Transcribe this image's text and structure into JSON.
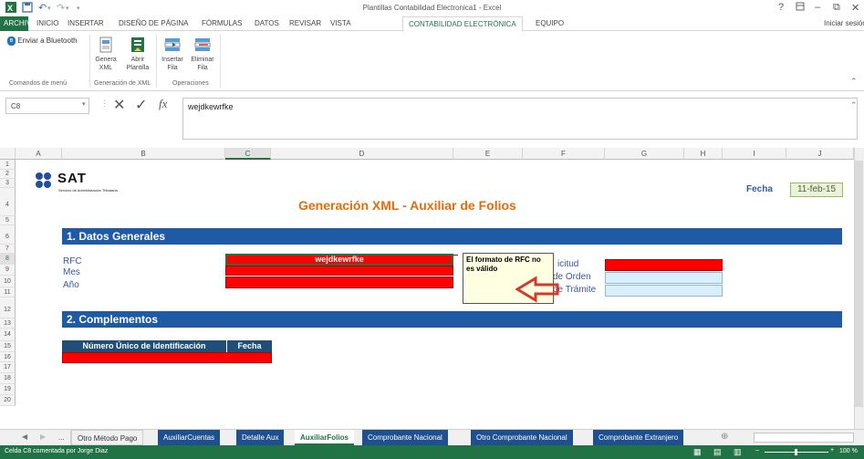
{
  "title_bar": {
    "title": "Plantillas Contabilidad Electronica1 - Excel",
    "help": "?",
    "minimize": "–",
    "restore": "⧉",
    "close": "✕"
  },
  "menu": {
    "file": "ARCHIVO",
    "tabs": [
      "INICIO",
      "INSERTAR",
      "DISEÑO DE PÁGINA",
      "FÓRMULAS",
      "DATOS",
      "REVISAR",
      "VISTA",
      "CONTABILIDAD ELECTRÓNICA",
      "EQUIPO"
    ],
    "signin": "Iniciar sesión"
  },
  "ribbon": {
    "bluetooth": "Enviar a Bluetooth",
    "genera": [
      "Genera",
      "XML"
    ],
    "abrir": [
      "Abrir",
      "Plantilla"
    ],
    "insertar": [
      "Insertar",
      "Fila"
    ],
    "eliminar": [
      "Eliminar",
      "Fila"
    ],
    "groups": [
      "Comandos de menú",
      "Generación de XML",
      "Operaciones"
    ]
  },
  "formula_bar": {
    "namebox": "C8",
    "fx": "fx",
    "value": "wejdkewrfke"
  },
  "columns": [
    "A",
    "B",
    "C",
    "D",
    "E",
    "F",
    "G",
    "H",
    "I",
    "J"
  ],
  "rows": [
    "1",
    "2",
    "3",
    "4",
    "5",
    "6",
    "7",
    "8",
    "9",
    "10",
    "11",
    "12",
    "13",
    "14",
    "15",
    "16",
    "17",
    "18",
    "19",
    "20"
  ],
  "sheet": {
    "logo_text": "SAT",
    "logo_sub": "Servicio de Administración Tributaria",
    "main_title": "Generación XML - Auxiliar de Folios",
    "fecha_label": "Fecha",
    "fecha_value": "11-feb-15",
    "section1": "1. Datos Generales",
    "rfc": "RFC",
    "mes": "Mes",
    "anio": "Año",
    "rfc_value": "wejdkewrfke",
    "comment": "El formato de RFC no es válido",
    "right_labels": [
      "icitud",
      "de Orden",
      "de Trámite"
    ],
    "section2": "2. Complementos",
    "table_headers": [
      "Número Único de Identificación",
      "Fecha"
    ]
  },
  "sheet_tabs": [
    "...",
    "Otro Método Pago",
    "AuxiliarCuentas",
    "Detalle Aux",
    "AuxiliarFolios",
    "Comprobante Nacional",
    "Otro Comprobante Nacional",
    "Comprobante Extranjero"
  ],
  "status": {
    "text": "Celda C8 comentada por Jorge Diaz",
    "zoom": "100 %"
  },
  "colors": {
    "excel_green": "#217346",
    "section_blue": "#1f5aa5",
    "red": "#ff0000",
    "title_orange": "#e46c0a"
  }
}
